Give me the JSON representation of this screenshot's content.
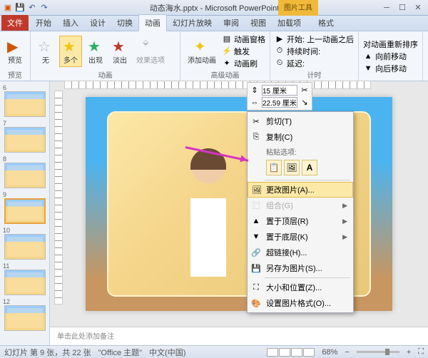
{
  "title": "动态海水.pptx - Microsoft PowerPoint",
  "context_title": "图片工具",
  "tabs": {
    "file": "文件",
    "items": [
      "开始",
      "插入",
      "设计",
      "切换",
      "动画",
      "幻灯片放映",
      "审阅",
      "视图",
      "加载项",
      "格式"
    ],
    "active": "动画"
  },
  "ribbon": {
    "preview": {
      "label": "预览",
      "group": "预览"
    },
    "anim": {
      "none": "无",
      "multi": "多个",
      "appear": "出现",
      "fadein": "淡出",
      "options": "效果选项",
      "group": "动画"
    },
    "adv": {
      "add": "添加动画",
      "pane": "动画窗格",
      "trigger": "触发",
      "painter": "动画刷",
      "group": "高级动画"
    },
    "timing": {
      "start": "开始:",
      "after": "上一动画之后",
      "duration": "持续时间:",
      "delay": "延迟:",
      "group": "计时"
    },
    "reorder": {
      "title": "对动画重新排序",
      "up": "向前移动",
      "down": "向后移动"
    }
  },
  "size_float": {
    "h": "15 厘米",
    "w": "22.59 厘米"
  },
  "ctx": {
    "cut": "剪切(T)",
    "copy": "复制(C)",
    "paste_label": "粘贴选项:",
    "change": "更改图片(A)...",
    "group": "组合(G)",
    "front": "置于顶层(R)",
    "back": "置于底层(K)",
    "link": "超链接(H)...",
    "saveas": "另存为图片(S)...",
    "sizepos": "大小和位置(Z)...",
    "format": "设置图片格式(O)..."
  },
  "thumbs": [
    6,
    7,
    8,
    9,
    10,
    11,
    12
  ],
  "notes_placeholder": "单击此处添加备注",
  "status": {
    "slide": "幻灯片 第 9 张，共 22 张",
    "theme": "\"Office 主题\"",
    "lang": "中文(中国)",
    "zoom": "68%"
  }
}
